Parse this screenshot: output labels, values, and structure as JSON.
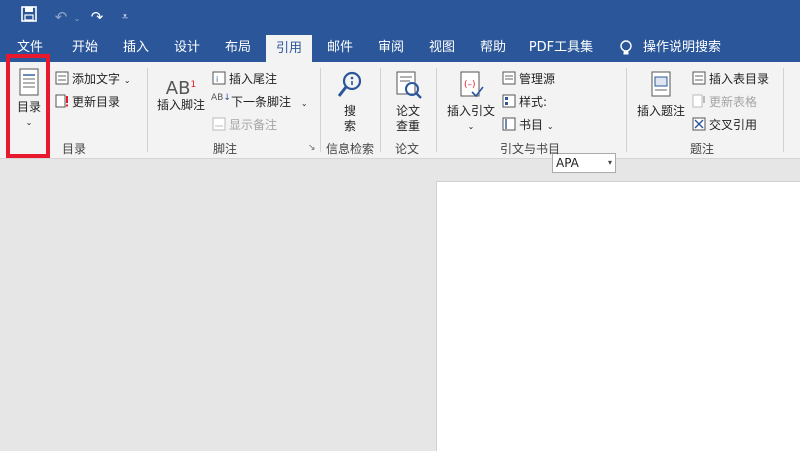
{
  "qat": {
    "save_icon": "save-icon",
    "undo_icon": "undo-icon",
    "redo_icon": "redo-icon",
    "customize_icon": "customize-icon"
  },
  "tabs": [
    {
      "label": "文件"
    },
    {
      "label": "开始"
    },
    {
      "label": "插入"
    },
    {
      "label": "设计"
    },
    {
      "label": "布局"
    },
    {
      "label": "引用"
    },
    {
      "label": "邮件"
    },
    {
      "label": "审阅"
    },
    {
      "label": "视图"
    },
    {
      "label": "帮助"
    },
    {
      "label": "PDF工具集"
    },
    {
      "label": "操作说明搜索"
    }
  ],
  "ribbon": {
    "toc": {
      "toc_label": "目录",
      "add_text": "添加文字",
      "update_toc": "更新目录",
      "group": "目录"
    },
    "footnotes": {
      "insert_footnote": "插入脚注",
      "insert_endnote": "插入尾注",
      "next_footnote": "下一条脚注",
      "show_notes": "显示备注",
      "group": "脚注"
    },
    "research": {
      "search": "搜",
      "search2": "索",
      "group": "信息检索"
    },
    "paper": {
      "check1": "论文",
      "check2": "查重",
      "group": "论文"
    },
    "citations": {
      "insert_citation": "插入引文",
      "manage_sources": "管理源",
      "style_label": "样式:",
      "style_value": "APA",
      "bibliography": "书目",
      "group": "引文与书目"
    },
    "captions": {
      "insert_caption": "插入题注",
      "insert_table_of_figures": "插入表目录",
      "update_table": "更新表格",
      "cross_reference": "交叉引用",
      "group": "题注"
    }
  },
  "colors": {
    "brand": "#2b579a",
    "highlight": "#e8192c"
  }
}
